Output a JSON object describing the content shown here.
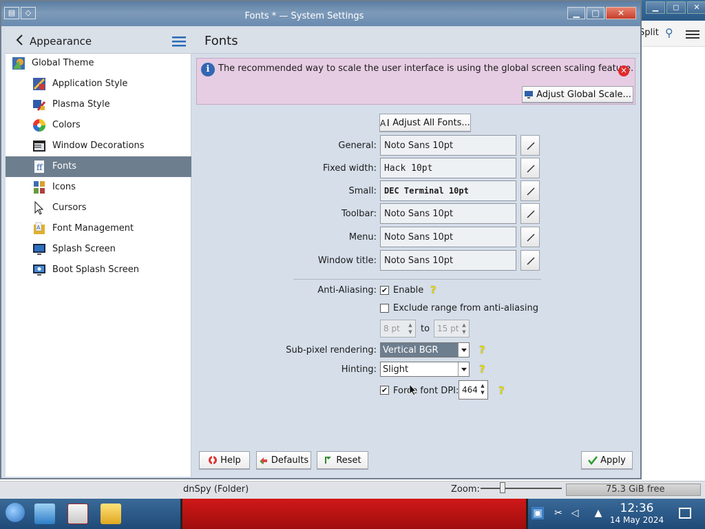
{
  "background": {
    "toolbar_split": "Split",
    "status_left": "dnSpy (Folder)",
    "zoom_label": "Zoom:",
    "free_space": "75.3 GiB free"
  },
  "taskbar": {
    "time": "12:36",
    "date": "14 May 2024"
  },
  "window": {
    "title": "Fonts * — System Settings",
    "sysmenu_icon": "◇",
    "minimize": "▁",
    "maximize": "□",
    "close": "✕"
  },
  "sidebar": {
    "title": "Appearance",
    "items": [
      {
        "label": "Global Theme",
        "icon": "global-theme-icon"
      },
      {
        "label": "Application Style",
        "icon": "application-style-icon"
      },
      {
        "label": "Plasma Style",
        "icon": "plasma-style-icon"
      },
      {
        "label": "Colors",
        "icon": "colors-icon"
      },
      {
        "label": "Window Decorations",
        "icon": "window-decorations-icon"
      },
      {
        "label": "Fonts",
        "icon": "fonts-icon"
      },
      {
        "label": "Icons",
        "icon": "icons-icon"
      },
      {
        "label": "Cursors",
        "icon": "cursors-icon"
      },
      {
        "label": "Font Management",
        "icon": "font-management-icon"
      },
      {
        "label": "Splash Screen",
        "icon": "splash-screen-icon"
      },
      {
        "label": "Boot Splash Screen",
        "icon": "boot-splash-screen-icon"
      }
    ],
    "selected": "Fonts"
  },
  "content": {
    "title": "Fonts",
    "banner": {
      "text": "The recommended way to scale the user interface is using the global screen scaling feature.",
      "button": "Adjust Global Scale..."
    },
    "adjust_all_button": "Adjust All Fonts...",
    "font_rows": [
      {
        "label": "General:",
        "value": "Noto Sans 10pt"
      },
      {
        "label": "Fixed width:",
        "value": "Hack 10pt"
      },
      {
        "label": "Small:",
        "value": "DEC Terminal 10pt"
      },
      {
        "label": "Toolbar:",
        "value": "Noto Sans 10pt"
      },
      {
        "label": "Menu:",
        "value": "Noto Sans 10pt"
      },
      {
        "label": "Window title:",
        "value": "Noto Sans 10pt"
      }
    ],
    "anti_aliasing": {
      "label": "Anti-Aliasing:",
      "enable_label": "Enable",
      "enabled": true,
      "exclude_label": "Exclude range from anti-aliasing",
      "exclude_checked": false,
      "range_from": "8 pt",
      "range_to_label": "to",
      "range_to": "15 pt"
    },
    "subpixel": {
      "label": "Sub-pixel rendering:",
      "value": "Vertical BGR"
    },
    "hinting": {
      "label": "Hinting:",
      "value": "Slight"
    },
    "force_dpi": {
      "label": "Force font DPI:",
      "checked": true,
      "value": "464"
    },
    "buttons": {
      "help": "Help",
      "defaults": "Defaults",
      "reset": "Reset",
      "apply": "Apply"
    }
  },
  "colors": {
    "selection": "#6d7e8e",
    "banner_bg": "#e6cde3",
    "content_bg": "#d5dee9"
  }
}
